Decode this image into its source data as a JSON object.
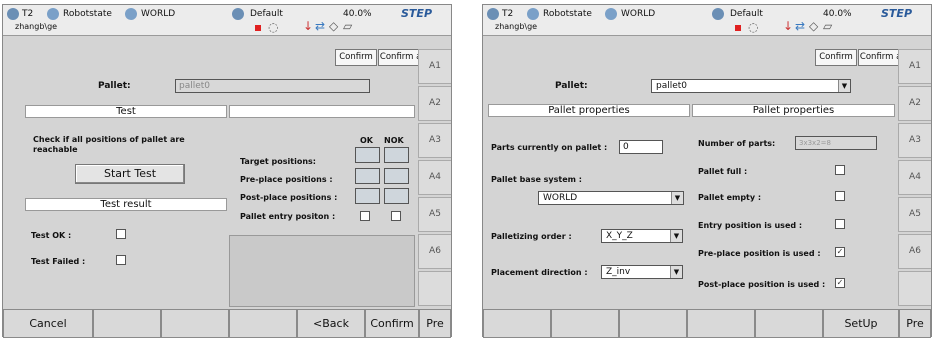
{
  "header": {
    "mode": "T2",
    "robot": "Robotstate",
    "coord": "WORLD",
    "tool": "Default",
    "speed": "40.0%",
    "brand": "STEP",
    "user": "zhangb\\ge",
    "red_indicator": "#e02020"
  },
  "topbar": {
    "confirm": "Confirm",
    "confirm_all": "Confirm all"
  },
  "side_tabs": [
    "A1",
    "A2",
    "A3",
    "A4",
    "A5",
    "A6"
  ],
  "left": {
    "pallet_label": "Pallet:",
    "pallet_value": "pallet0",
    "test_header": "Test",
    "check_text": "Check if all positions of pallet are reachable",
    "start_test": "Start Test",
    "result_header": "Test result",
    "test_ok": "Test OK :",
    "test_failed": "Test Failed :",
    "ok": "OK",
    "nok": "NOK",
    "target": "Target positions:",
    "preplace": "Pre-place positions :",
    "postplace": "Post-place positions :",
    "entry": "Pallet entry positon :",
    "bottom": [
      "Cancel",
      "",
      "",
      "",
      "<Back",
      "Confirm",
      "Pre"
    ]
  },
  "right": {
    "pallet_label": "Pallet:",
    "pallet_value": "pallet0",
    "props_left": "Pallet properties",
    "props_right": "Pallet properties",
    "parts_on": "Parts currently on pallet :",
    "parts_on_val": "0",
    "base_system": "Pallet base system :",
    "base_val": "WORLD",
    "order": "Palletizing order :",
    "order_val": "X_Y_Z",
    "placement": "Placement direction :",
    "placement_val": "Z_inv",
    "num_parts": "Number of parts:",
    "num_parts_val": "3x3x2=8",
    "full": "Pallet full :",
    "empty": "Pallet empty :",
    "entry_used": "Entry position is used :",
    "pre_used": "Pre-place position is used :",
    "post_used": "Post-place position is used :",
    "checkmark": "✓",
    "bottom": [
      "",
      "",
      "",
      "",
      "",
      "SetUp",
      "Pre"
    ]
  }
}
